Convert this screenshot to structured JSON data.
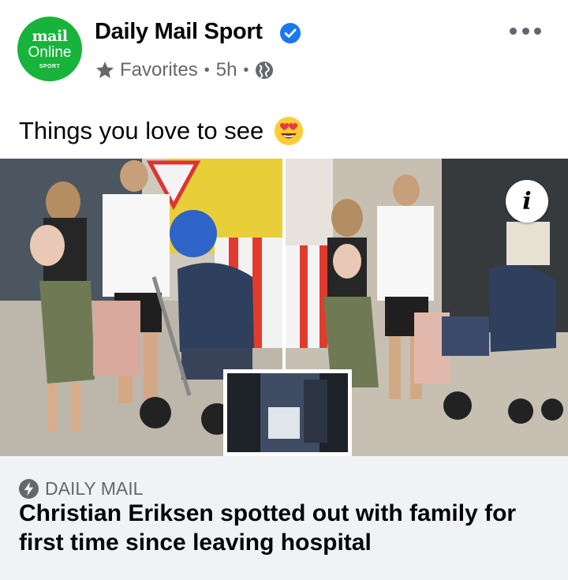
{
  "post": {
    "page_name": "Daily Mail Sport",
    "avatar": {
      "line1": "mail",
      "line2": "Online",
      "line3": "SPORT",
      "color": "#17b33a"
    },
    "audience_label": "Favorites",
    "timestamp": "5h",
    "separator": "•",
    "caption": "Things you love to see",
    "caption_emoji": "heart-eyes-emoji"
  },
  "link_preview": {
    "source": "DAILY MAIL",
    "headline": "Christian Eriksen spotted out with family for first time since leaving hospital",
    "info_label": "i"
  },
  "colors": {
    "verified_blue": "#1877f2",
    "meta_gray": "#65676b",
    "preview_bg": "#f0f2f5"
  }
}
